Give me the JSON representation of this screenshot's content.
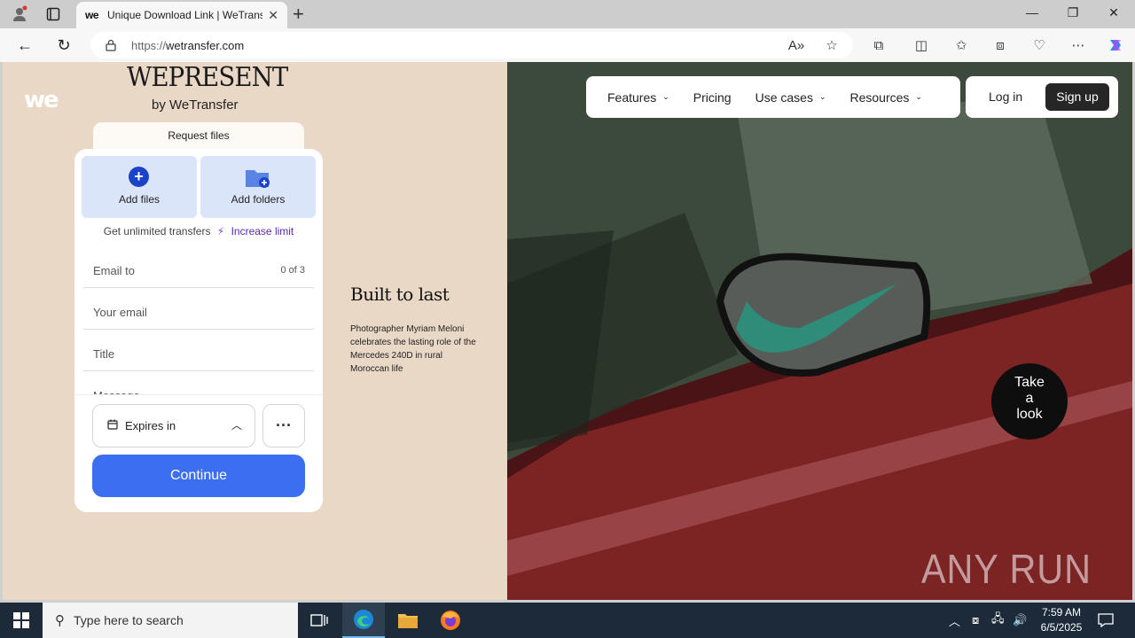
{
  "browser": {
    "tab_title": "Unique Download Link | WeTrans",
    "tab_favicon": "we",
    "url_scheme": "https://",
    "url_host": "wetransfer.com"
  },
  "header": {
    "logo": "we",
    "brand_title": "WEPRESENT",
    "brand_sub": "by WeTransfer"
  },
  "nav": {
    "items": [
      {
        "label": "Features",
        "dropdown": true
      },
      {
        "label": "Pricing",
        "dropdown": false
      },
      {
        "label": "Use cases",
        "dropdown": true
      },
      {
        "label": "Resources",
        "dropdown": true
      }
    ],
    "login": "Log in",
    "signup": "Sign up"
  },
  "upload": {
    "tab_label": "Request files",
    "add_files": "Add files",
    "add_folders": "Add folders",
    "unlimited_text": "Get unlimited transfers",
    "increase_limit": "Increase limit",
    "email_to": "Email to",
    "email_count": "0 of 3",
    "your_email": "Your email",
    "title": "Title",
    "message": "Message",
    "expires": "Expires in",
    "continue": "Continue"
  },
  "article": {
    "title": "Built to last",
    "description": "Photographer Myriam Meloni celebrates the lasting role of the Mercedes 240D in rural Moroccan life",
    "cta": [
      "Take",
      "a",
      "look"
    ]
  },
  "watermark": "ANY RUN",
  "taskbar": {
    "search_placeholder": "Type here to search",
    "time": "7:59 AM",
    "date": "6/5/2025"
  },
  "colors": {
    "page_bg": "#ead8c7",
    "primary_blue": "#3b6ef0",
    "purple_link": "#5a27b0",
    "taskbar": "#1c2a3a"
  }
}
